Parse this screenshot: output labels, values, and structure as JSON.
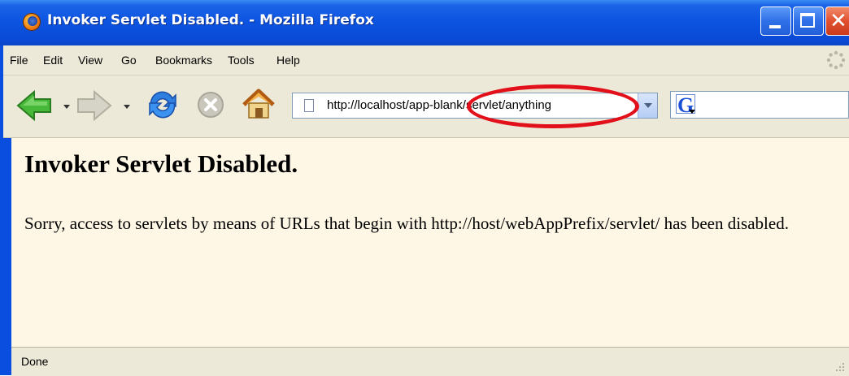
{
  "window": {
    "title": "Invoker Servlet Disabled. - Mozilla Firefox"
  },
  "menu": [
    "File",
    "Edit",
    "View",
    "Go",
    "Bookmarks",
    "Tools",
    "Help"
  ],
  "toolbar": {
    "url": "http://localhost/app-blank/servlet/anything",
    "search_engine_icon": "google-icon",
    "search_value": ""
  },
  "page": {
    "heading": "Invoker Servlet Disabled.",
    "body": "Sorry, access to servlets by means of URLs that begin with http://host/webAppPrefix/servlet/ has been disabled."
  },
  "status": {
    "text": "Done"
  },
  "colors": {
    "titlebar": "#0b53e0",
    "content_bg": "#fff7e6",
    "chrome": "#ece9d8",
    "annotation": "#e2101a"
  }
}
